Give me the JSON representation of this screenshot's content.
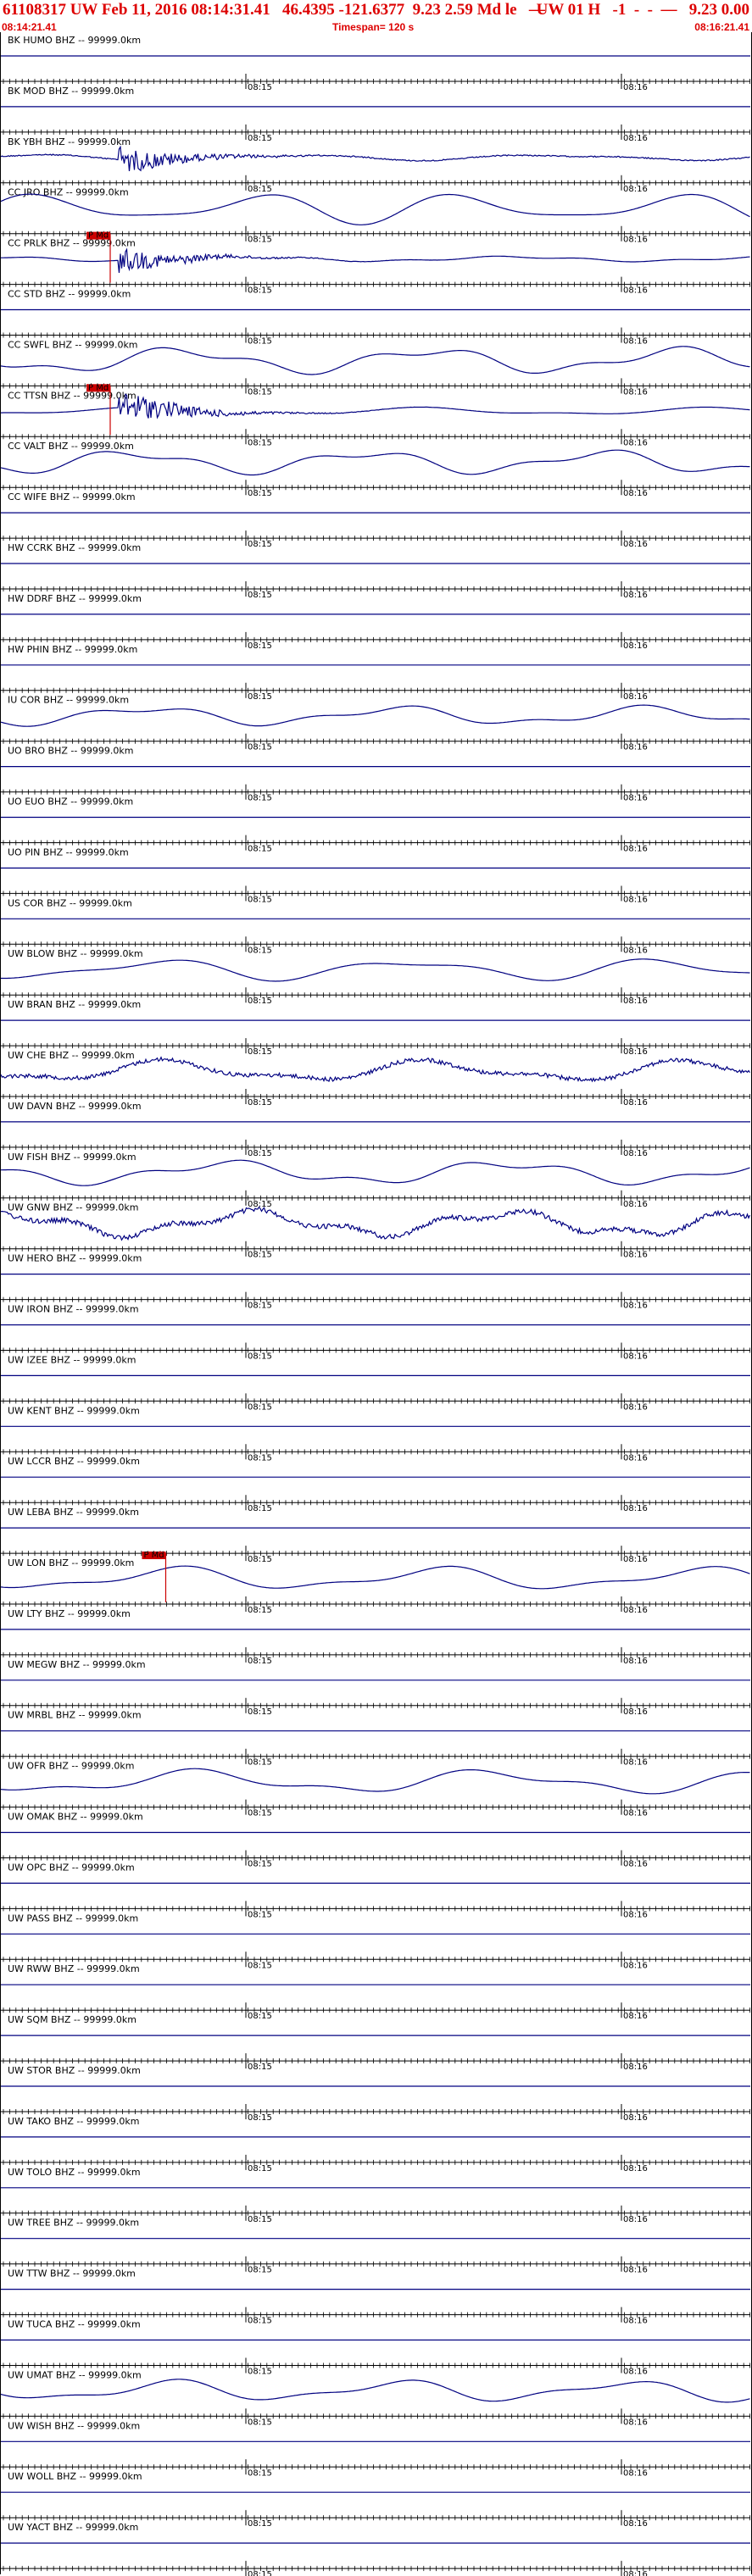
{
  "header": {
    "title": "61108317 UW Feb 11, 2016 08:14:31.41   46.4395 -121.6377  9.23 2.59 Md le   —",
    "title_right": "UW 01 H   -1  -  -  —   9.23 0.00",
    "start_time": "08:14:21.41",
    "timespan": "Timespan= 120 s",
    "end_time": "08:16:21.41"
  },
  "chart_data": {
    "type": "line",
    "title": "",
    "xlabel": "",
    "ylabel": "",
    "x_ticks": [
      "08:15",
      "08:16"
    ],
    "trace_color": "#000080",
    "pick_color": "#cc0000",
    "channels": [
      {
        "label": "BK HUMO BHZ -- 99999.0km",
        "kind": "flat"
      },
      {
        "label": "BK MOD BHZ -- 99999.0km",
        "kind": "flat"
      },
      {
        "label": "BK YBH BHZ -- 99999.0km",
        "kind": "noisy_event",
        "amp": 0.55
      },
      {
        "label": "CC JRO BHZ -- 99999.0km",
        "kind": "wave",
        "amp": 0.7
      },
      {
        "label": "CC PRLK BHZ -- 99999.0km",
        "kind": "event",
        "amp": 0.5,
        "pick": true,
        "pick_label": "P Md"
      },
      {
        "label": "CC STD BHZ -- 99999.0km",
        "kind": "flat"
      },
      {
        "label": "CC SWFL BHZ -- 99999.0km",
        "kind": "wave",
        "amp": 0.6
      },
      {
        "label": "CC TTSN BHZ -- 99999.0km",
        "kind": "event",
        "amp": 0.7,
        "pick": true,
        "pick_label": "P Md"
      },
      {
        "label": "CC VALT BHZ -- 99999.0km",
        "kind": "wave",
        "amp": 0.55
      },
      {
        "label": "CC WIFE BHZ -- 99999.0km",
        "kind": "flat"
      },
      {
        "label": "HW CCRK BHZ -- 99999.0km",
        "kind": "flat"
      },
      {
        "label": "HW DDRF BHZ -- 99999.0km",
        "kind": "flat"
      },
      {
        "label": "HW PHIN BHZ -- 99999.0km",
        "kind": "flat"
      },
      {
        "label": "IU COR BHZ -- 99999.0km",
        "kind": "wave",
        "amp": 0.45
      },
      {
        "label": "UO BRO BHZ -- 99999.0km",
        "kind": "flat"
      },
      {
        "label": "UO EUO BHZ -- 99999.0km",
        "kind": "flat"
      },
      {
        "label": "UO PIN BHZ -- 99999.0km",
        "kind": "flat"
      },
      {
        "label": "US COR BHZ -- 99999.0km",
        "kind": "flat"
      },
      {
        "label": "UW BLOW BHZ -- 99999.0km",
        "kind": "wave",
        "amp": 0.5
      },
      {
        "label": "UW BRAN BHZ -- 99999.0km",
        "kind": "flat"
      },
      {
        "label": "UW CHE BHZ -- 99999.0km",
        "kind": "noisy_wave",
        "amp": 0.5
      },
      {
        "label": "UW DAVN BHZ -- 99999.0km",
        "kind": "flat"
      },
      {
        "label": "UW FISH BHZ -- 99999.0km",
        "kind": "wave",
        "amp": 0.55
      },
      {
        "label": "UW GNW BHZ -- 99999.0km",
        "kind": "noisy_wave",
        "amp": 0.6
      },
      {
        "label": "UW HERO BHZ -- 99999.0km",
        "kind": "flat"
      },
      {
        "label": "UW IRON BHZ -- 99999.0km",
        "kind": "flat"
      },
      {
        "label": "UW IZEE BHZ -- 99999.0km",
        "kind": "flat"
      },
      {
        "label": "UW KENT BHZ -- 99999.0km",
        "kind": "flat"
      },
      {
        "label": "UW LCCR BHZ -- 99999.0km",
        "kind": "flat"
      },
      {
        "label": "UW LEBA BHZ -- 99999.0km",
        "kind": "flat"
      },
      {
        "label": "UW LON BHZ -- 99999.0km",
        "kind": "wave",
        "amp": 0.55,
        "pick": true,
        "pick_label": "P Md",
        "pick_at": 0.22
      },
      {
        "label": "UW LTY BHZ -- 99999.0km",
        "kind": "flat"
      },
      {
        "label": "UW MEGW BHZ -- 99999.0km",
        "kind": "flat"
      },
      {
        "label": "UW MRBL BHZ -- 99999.0km",
        "kind": "flat"
      },
      {
        "label": "UW OFR BHZ -- 99999.0km",
        "kind": "wave",
        "amp": 0.55
      },
      {
        "label": "UW OMAK BHZ -- 99999.0km",
        "kind": "flat"
      },
      {
        "label": "UW OPC BHZ -- 99999.0km",
        "kind": "flat"
      },
      {
        "label": "UW PASS BHZ -- 99999.0km",
        "kind": "flat"
      },
      {
        "label": "UW RWW BHZ -- 99999.0km",
        "kind": "flat"
      },
      {
        "label": "UW SQM BHZ -- 99999.0km",
        "kind": "flat"
      },
      {
        "label": "UW STOR BHZ -- 99999.0km",
        "kind": "flat"
      },
      {
        "label": "UW TAKO BHZ -- 99999.0km",
        "kind": "flat"
      },
      {
        "label": "UW TOLO BHZ -- 99999.0km",
        "kind": "flat"
      },
      {
        "label": "UW TREE BHZ -- 99999.0km",
        "kind": "flat"
      },
      {
        "label": "UW TTW BHZ -- 99999.0km",
        "kind": "flat"
      },
      {
        "label": "UW TUCA BHZ -- 99999.0km",
        "kind": "flat"
      },
      {
        "label": "UW UMAT BHZ -- 99999.0km",
        "kind": "wave",
        "amp": 0.5
      },
      {
        "label": "UW WISH BHZ -- 99999.0km",
        "kind": "flat"
      },
      {
        "label": "UW WOLL BHZ -- 99999.0km",
        "kind": "flat"
      },
      {
        "label": "UW YACT BHZ -- 99999.0km",
        "kind": "flat"
      }
    ]
  }
}
